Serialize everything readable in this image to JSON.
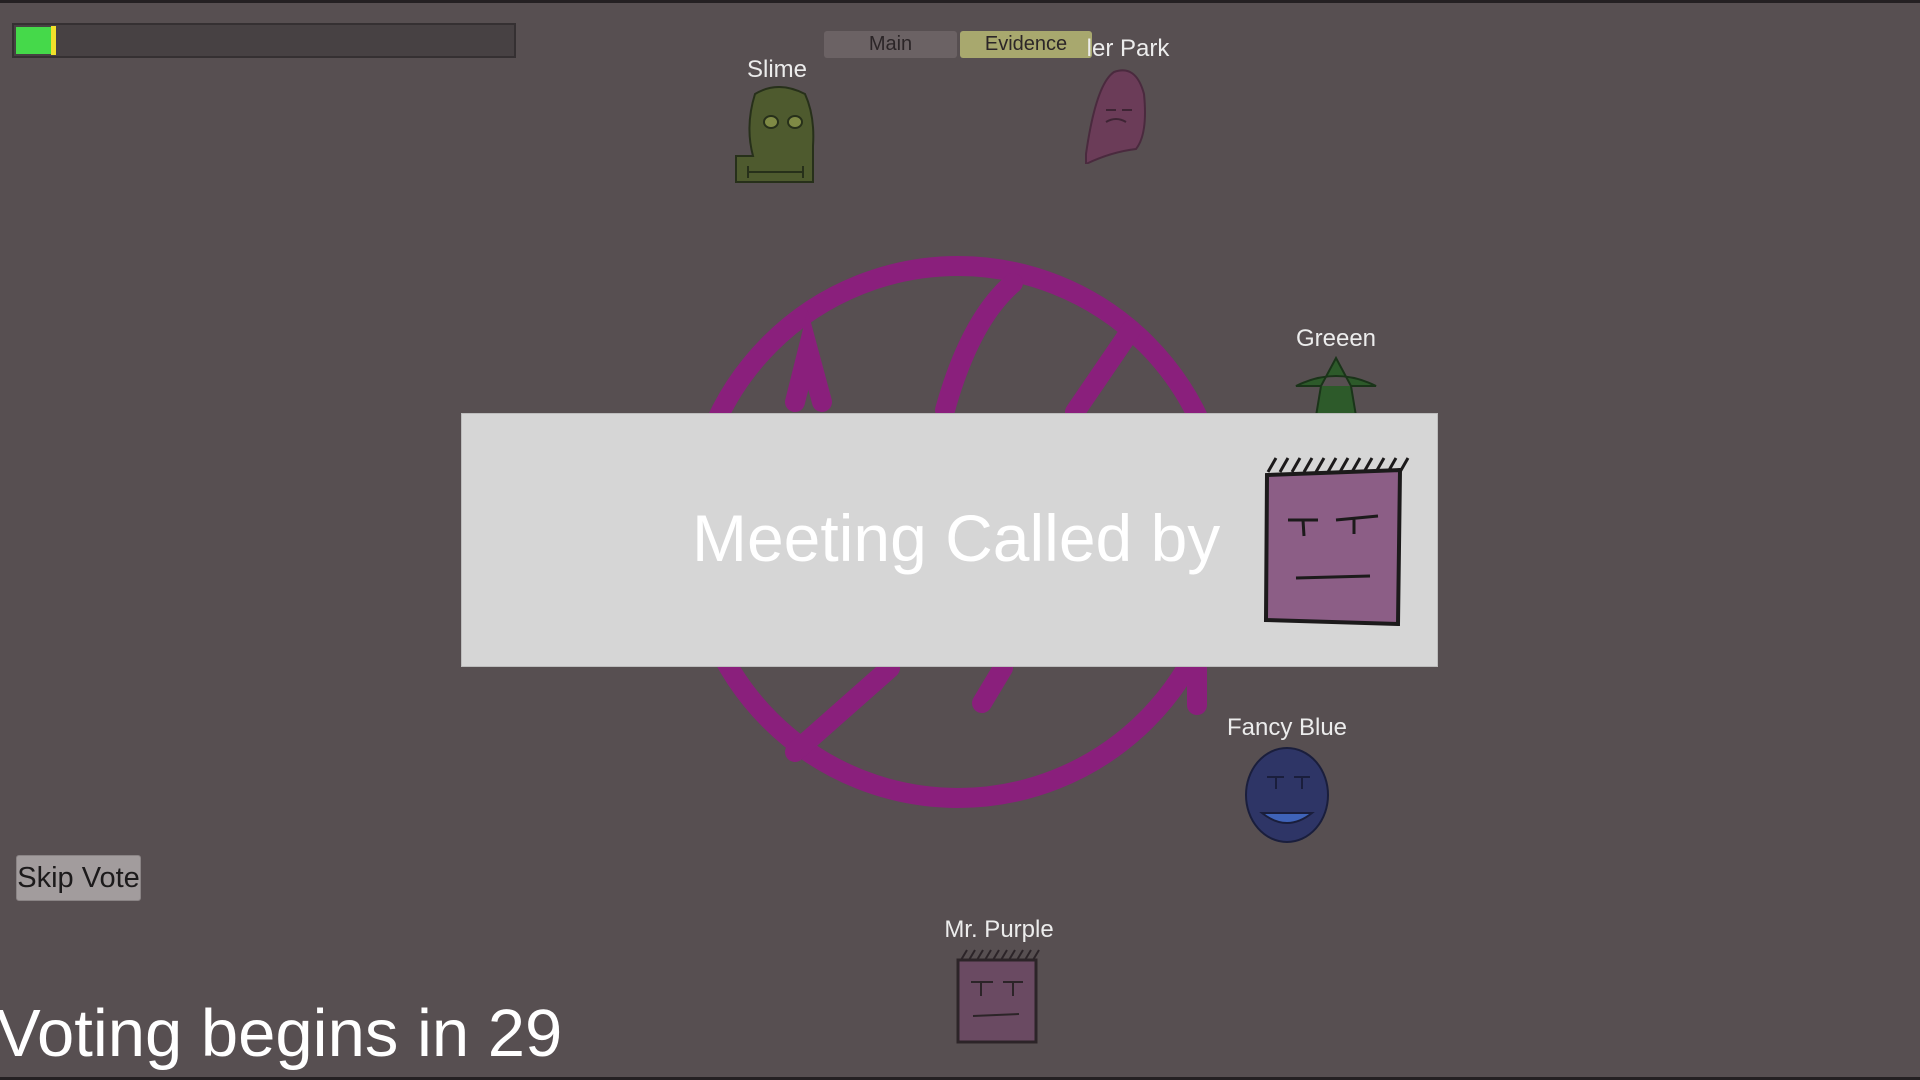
{
  "hud": {
    "task_progress": 0.07,
    "tabs": [
      {
        "label": "Main"
      },
      {
        "label": "Evidence"
      }
    ]
  },
  "players": [
    {
      "name": "Slime",
      "color": "#4e5a2e"
    },
    {
      "name": "ler Park",
      "color": "#6b3c58"
    },
    {
      "name": "Greeen",
      "color": "#2d5a2a"
    },
    {
      "name": "Fancy Blue",
      "color": "#2e3566"
    },
    {
      "name": "Mr. Purple",
      "color": "#6a4a62"
    }
  ],
  "meeting": {
    "text": "Meeting Called by",
    "caller_icon": "mr-purple-avatar-icon"
  },
  "emblem": {
    "color": "#8a1f7c",
    "icon": "meeting-emblem-icon"
  },
  "controls": {
    "skip_vote_label": "Skip Vote",
    "countdown_text": "Voting begins in 29"
  }
}
